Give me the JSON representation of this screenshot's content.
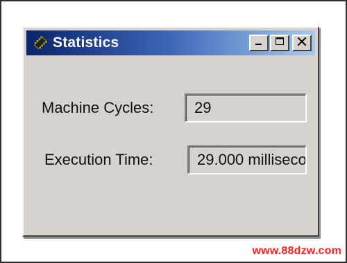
{
  "window": {
    "title": "Statistics"
  },
  "stats": {
    "machine_cycles_label": "Machine Cycles:",
    "machine_cycles_value": "29",
    "execution_time_label": "Execution Time:",
    "execution_time_value": "29.000 milliseco"
  },
  "watermark": {
    "text": "www.88dzw.com"
  },
  "colors": {
    "titlebar_start": "#0a246a",
    "titlebar_end": "#a6caf0",
    "window_face": "#d6d3ce",
    "watermark": "#ff1f1f"
  },
  "icons": {
    "window_icon": "chip-icon",
    "minimize": "minimize-icon",
    "maximize": "maximize-icon",
    "close": "close-icon"
  }
}
